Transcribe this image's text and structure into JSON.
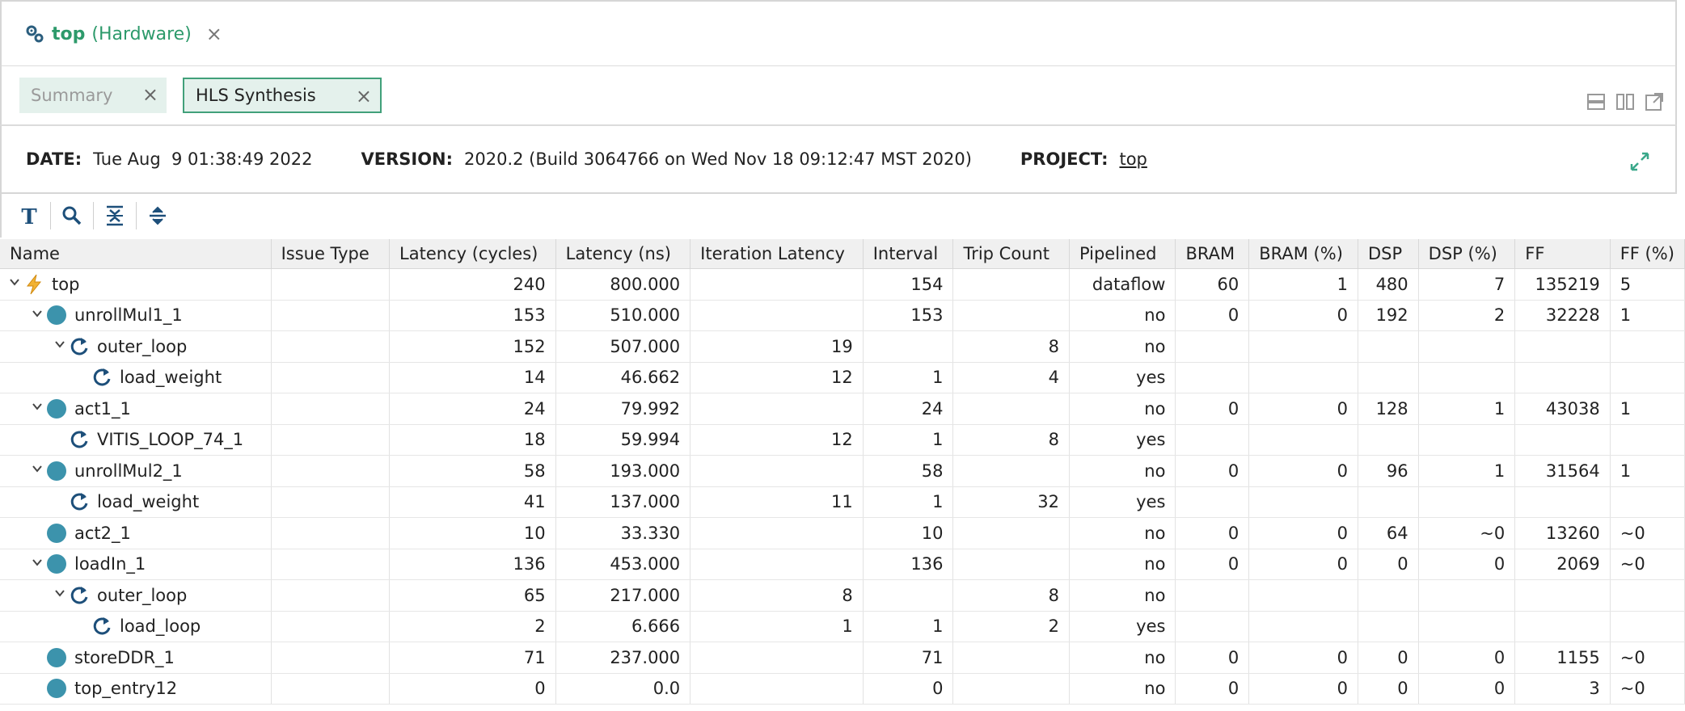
{
  "editor_tab": {
    "name": "top",
    "subtitle": "(Hardware)",
    "close": "×"
  },
  "subtabs": [
    {
      "label": "Summary",
      "close": "×"
    },
    {
      "label": "HLS Synthesis",
      "close": "×"
    }
  ],
  "info": {
    "date_label": "DATE:",
    "date_value": "Tue Aug  9 01:38:49 2022",
    "version_label": "VERSION:",
    "version_value": "2020.2 (Build 3064766 on Wed Nov 18 09:12:47 MST 2020)",
    "project_label": "PROJECT:",
    "project_value": "top"
  },
  "toolbar_icons": [
    "text-format-icon",
    "search-icon",
    "collapse-all-icon",
    "expand-all-icon"
  ],
  "columns": [
    "Name",
    "Issue Type",
    "Latency (cycles)",
    "Latency (ns)",
    "Iteration Latency",
    "Interval",
    "Trip Count",
    "Pipelined",
    "BRAM",
    "BRAM (%)",
    "DSP",
    "DSP (%)",
    "FF",
    "FF (%)"
  ],
  "rows": [
    {
      "level": 0,
      "toggle": "v",
      "icon": "bolt",
      "name": "top",
      "cells": [
        "",
        "240",
        "800.000",
        "",
        "154",
        "",
        "dataflow",
        "60",
        "1",
        "480",
        "7",
        "135219",
        "5"
      ]
    },
    {
      "level": 1,
      "toggle": "v",
      "icon": "dot",
      "name": "unrollMul1_1",
      "cells": [
        "",
        "153",
        "510.000",
        "",
        "153",
        "",
        "no",
        "0",
        "0",
        "192",
        "2",
        "32228",
        "1"
      ]
    },
    {
      "level": 2,
      "toggle": "v",
      "icon": "loop",
      "name": "outer_loop",
      "cells": [
        "",
        "152",
        "507.000",
        "19",
        "",
        "8",
        "no",
        "",
        "",
        "",
        "",
        "",
        ""
      ]
    },
    {
      "level": 3,
      "toggle": "",
      "icon": "loop",
      "name": "load_weight",
      "cells": [
        "",
        "14",
        "46.662",
        "12",
        "1",
        "4",
        "yes",
        "",
        "",
        "",
        "",
        "",
        ""
      ]
    },
    {
      "level": 1,
      "toggle": "v",
      "icon": "dot",
      "name": "act1_1",
      "cells": [
        "",
        "24",
        "79.992",
        "",
        "24",
        "",
        "no",
        "0",
        "0",
        "128",
        "1",
        "43038",
        "1"
      ]
    },
    {
      "level": 2,
      "toggle": "",
      "icon": "loop",
      "name": "VITIS_LOOP_74_1",
      "cells": [
        "",
        "18",
        "59.994",
        "12",
        "1",
        "8",
        "yes",
        "",
        "",
        "",
        "",
        "",
        ""
      ]
    },
    {
      "level": 1,
      "toggle": "v",
      "icon": "dot",
      "name": "unrollMul2_1",
      "cells": [
        "",
        "58",
        "193.000",
        "",
        "58",
        "",
        "no",
        "0",
        "0",
        "96",
        "1",
        "31564",
        "1"
      ]
    },
    {
      "level": 2,
      "toggle": "",
      "icon": "loop",
      "name": "load_weight",
      "cells": [
        "",
        "41",
        "137.000",
        "11",
        "1",
        "32",
        "yes",
        "",
        "",
        "",
        "",
        "",
        ""
      ]
    },
    {
      "level": 1,
      "toggle": "",
      "icon": "dot",
      "name": "act2_1",
      "cells": [
        "",
        "10",
        "33.330",
        "",
        "10",
        "",
        "no",
        "0",
        "0",
        "64",
        "~0",
        "13260",
        "~0"
      ]
    },
    {
      "level": 1,
      "toggle": "v",
      "icon": "dot",
      "name": "loadIn_1",
      "cells": [
        "",
        "136",
        "453.000",
        "",
        "136",
        "",
        "no",
        "0",
        "0",
        "0",
        "0",
        "2069",
        "~0"
      ]
    },
    {
      "level": 2,
      "toggle": "v",
      "icon": "loop",
      "name": "outer_loop",
      "cells": [
        "",
        "65",
        "217.000",
        "8",
        "",
        "8",
        "no",
        "",
        "",
        "",
        "",
        "",
        ""
      ]
    },
    {
      "level": 3,
      "toggle": "",
      "icon": "loop",
      "name": "load_loop",
      "cells": [
        "",
        "2",
        "6.666",
        "1",
        "1",
        "2",
        "yes",
        "",
        "",
        "",
        "",
        "",
        ""
      ]
    },
    {
      "level": 1,
      "toggle": "",
      "icon": "dot",
      "name": "storeDDR_1",
      "cells": [
        "",
        "71",
        "237.000",
        "",
        "71",
        "",
        "no",
        "0",
        "0",
        "0",
        "0",
        "1155",
        "~0"
      ]
    },
    {
      "level": 1,
      "toggle": "",
      "icon": "dot",
      "name": "top_entry12",
      "cells": [
        "",
        "0",
        "0.0",
        "",
        "0",
        "",
        "no",
        "0",
        "0",
        "0",
        "0",
        "3",
        "~0"
      ]
    }
  ]
}
